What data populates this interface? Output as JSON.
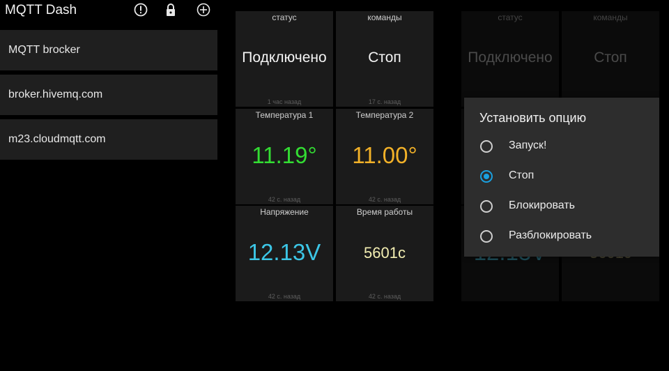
{
  "app": {
    "title": "MQTT Dash"
  },
  "icons": [
    "alert-icon",
    "lock-icon",
    "add-icon"
  ],
  "brokers": [
    {
      "label": "MQTT brocker"
    },
    {
      "label": "broker.hivemq.com"
    },
    {
      "label": "m23.cloudmqtt.com"
    }
  ],
  "tiles": [
    {
      "label": "статус",
      "value": "Подключено",
      "time": "1 час назад",
      "color": "#f4f4f4"
    },
    {
      "label": "команды",
      "value": "Стоп",
      "time": "17 с. назад",
      "color": "#f4f4f4"
    },
    {
      "label": "Температура 1",
      "value": "11.19°",
      "time": "42 с. назад",
      "color": "#33dd33"
    },
    {
      "label": "Температура 2",
      "value": "11.00°",
      "time": "42 с. назад",
      "color": "#f2b128"
    },
    {
      "label": "Напряжение",
      "value": "12.13V",
      "time": "42 с. назад",
      "color": "#3cc6e6"
    },
    {
      "label": "Время работы",
      "value": "5601c",
      "time": "42 с. назад",
      "color": "#f3eeb2"
    }
  ],
  "background_tiles": [
    {
      "label": "статус",
      "value": "Подключено",
      "time": ""
    },
    {
      "label": "команды",
      "value": "Стоп",
      "time": ""
    },
    {
      "label": "",
      "value": "",
      "time": ""
    },
    {
      "label": "",
      "value": "",
      "time": ""
    },
    {
      "label": "",
      "value": "12.13V",
      "time": ""
    },
    {
      "label": "",
      "value": "5601c",
      "time": ""
    }
  ],
  "dialog": {
    "title": "Установить опцию",
    "options": [
      {
        "label": "Запуск!",
        "selected": false
      },
      {
        "label": "Стоп",
        "selected": true
      },
      {
        "label": "Блокировать",
        "selected": false
      },
      {
        "label": "Разблокировать",
        "selected": false
      }
    ]
  },
  "colors": {
    "accent": "#1aa0e0"
  }
}
